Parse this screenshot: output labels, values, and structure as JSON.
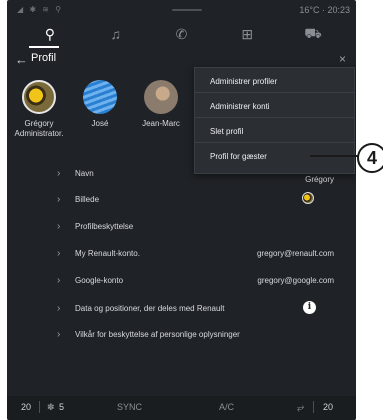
{
  "status": {
    "left": "◢ ✱ ≋ ⚲",
    "right": "16°C · 20:23"
  },
  "nav": [
    {
      "name": "location-pin-icon",
      "glyph": "⚲"
    },
    {
      "name": "music-note-icon",
      "glyph": "♫"
    },
    {
      "name": "phone-icon",
      "glyph": "✆"
    },
    {
      "name": "apps-grid-icon",
      "glyph": "⊞"
    },
    {
      "name": "car-icon",
      "glyph": "⛟"
    }
  ],
  "header": {
    "back": "←",
    "title": "Profil",
    "close": "×"
  },
  "profiles": [
    {
      "name": "Grégory",
      "sub": "Administrator."
    },
    {
      "name": "José",
      "sub": ""
    },
    {
      "name": "Jean-Marc",
      "sub": ""
    }
  ],
  "rows": [
    {
      "label": "Navn",
      "value": "Grégory"
    },
    {
      "label": "Billede",
      "value": ""
    },
    {
      "label": "Profilbeskyttelse",
      "value": ""
    },
    {
      "label": "My Renault-konto.",
      "value": "gregory@renault.com"
    },
    {
      "label": "Google-konto",
      "value": "gregory@google.com"
    },
    {
      "label": "Data og positioner, der deles med Renault",
      "value": ""
    },
    {
      "label": "Vilkår for beskyttelse af personlige oplysninger",
      "value": ""
    }
  ],
  "menu": [
    "Administrer profiler",
    "Administrer konti",
    "Slet profil",
    "Profil for gæster"
  ],
  "bottom": {
    "temp_left": "20",
    "fan_level": "5",
    "sync": "SYNC",
    "ac": "A/C",
    "temp_right": "20"
  },
  "callout": "4",
  "info_glyph": "i",
  "chevron": "›"
}
